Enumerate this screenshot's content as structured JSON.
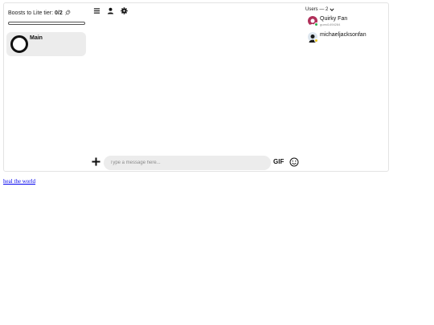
{
  "boost": {
    "label": "Boosts to Lite tier:",
    "count": "0/2",
    "progress": 0
  },
  "server": {
    "name": "Main"
  },
  "toolbar": {
    "icons": [
      "menu-icon",
      "person-icon",
      "gear-icon"
    ]
  },
  "composer": {
    "placeholder": "Type a message here...",
    "gif_label": "GIF"
  },
  "users": {
    "header": "Users — 2",
    "list": [
      {
        "name": "Quirky Fan",
        "subtitle": "guest1494284",
        "avatar_color": "#b0305a",
        "status_color": "#2bb24c"
      },
      {
        "name": "michaeljacksonfan",
        "subtitle": "",
        "avatar_color": "#1a1a1a",
        "status_color": "#e6c21a"
      }
    ]
  },
  "footer": {
    "link_text": "heal the world"
  },
  "colors": {
    "card_bg": "#ececec",
    "link": "#0000ee"
  }
}
